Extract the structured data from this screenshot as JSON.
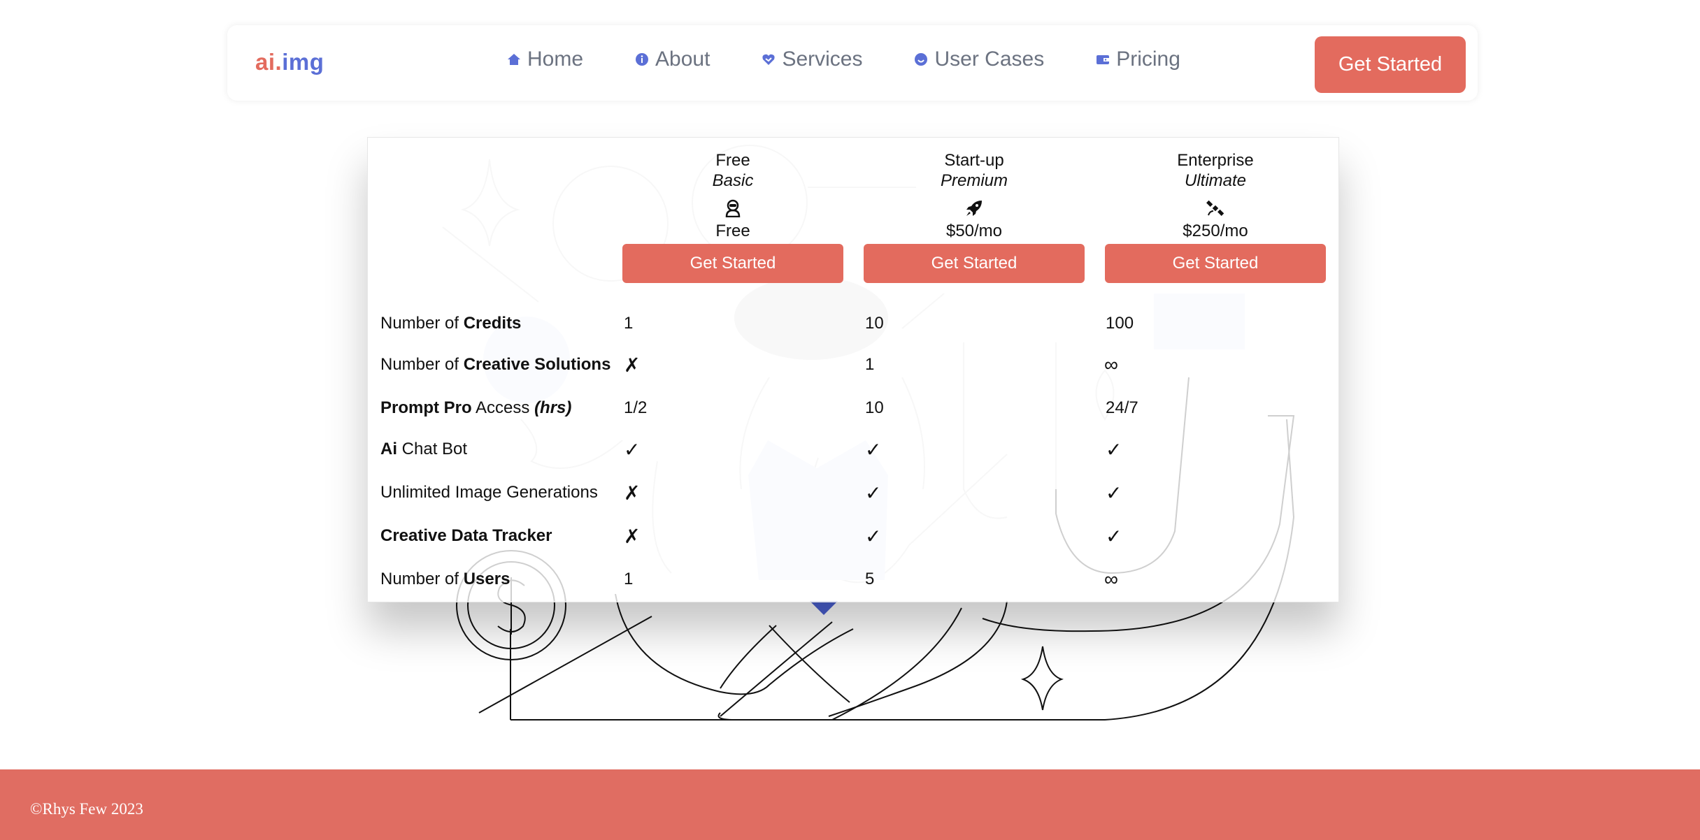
{
  "brand": {
    "part1": "ai.",
    "part2": "img"
  },
  "nav": [
    {
      "label": "Home",
      "icon": "home-icon"
    },
    {
      "label": "About",
      "icon": "info-icon"
    },
    {
      "label": "Services",
      "icon": "services-icon"
    },
    {
      "label": "User Cases",
      "icon": "user-cases-icon"
    },
    {
      "label": "Pricing",
      "icon": "wallet-icon"
    }
  ],
  "nav_cta": "Get Started",
  "plans": [
    {
      "name": "Free",
      "tier": "Basic",
      "icon": "user-astronaut-icon",
      "price": "Free",
      "cta": "Get Started"
    },
    {
      "name": "Start-up",
      "tier": "Premium",
      "icon": "rocket-icon",
      "price": "$50/mo",
      "cta": "Get Started"
    },
    {
      "name": "Enterprise",
      "tier": "Ultimate",
      "icon": "satellite-icon",
      "price": "$250/mo",
      "cta": "Get Started"
    }
  ],
  "features": [
    {
      "prefix": "Number of ",
      "bold": "Credits",
      "suffix": "",
      "values": [
        "1",
        "10",
        "100"
      ]
    },
    {
      "prefix": "Number of ",
      "bold": "Creative Solutions",
      "suffix": "",
      "values": [
        "✗",
        "1",
        "∞"
      ]
    },
    {
      "prefix": "",
      "bold": "Prompt Pro",
      "suffix": " Access ",
      "italic": "(hrs)",
      "values": [
        "1/2",
        "10",
        "24/7"
      ]
    },
    {
      "prefix": "",
      "bold": "Ai",
      "suffix": " Chat Bot",
      "values": [
        "✓",
        "✓",
        "✓"
      ]
    },
    {
      "prefix": "Unlimited Image Generations",
      "bold": "",
      "suffix": "",
      "values": [
        "✗",
        "✓",
        "✓"
      ]
    },
    {
      "prefix": "",
      "bold": "Creative Data Tracker",
      "suffix": "",
      "values": [
        "✗",
        "✓",
        "✓"
      ]
    },
    {
      "prefix": "Number of ",
      "bold": "Users",
      "suffix": "",
      "values": [
        "1",
        "5",
        "∞"
      ]
    }
  ],
  "footer": {
    "copyright": "©Rhys Few 2023"
  },
  "colors": {
    "accent": "#e36b5e",
    "brand_blue": "#5b6fd6",
    "footer": "#e06d62",
    "nav_text": "#6b7280"
  }
}
